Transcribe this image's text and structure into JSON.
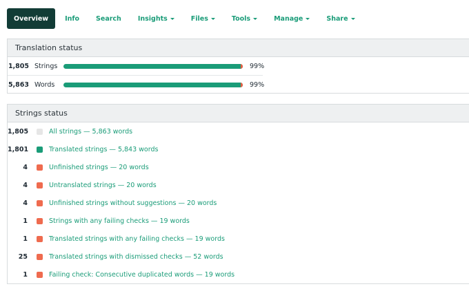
{
  "nav": {
    "tabs": [
      {
        "label": "Overview",
        "active": true,
        "dropdown": false
      },
      {
        "label": "Info",
        "active": false,
        "dropdown": false
      },
      {
        "label": "Search",
        "active": false,
        "dropdown": false
      },
      {
        "label": "Insights",
        "active": false,
        "dropdown": true
      },
      {
        "label": "Files",
        "active": false,
        "dropdown": true
      },
      {
        "label": "Tools",
        "active": false,
        "dropdown": true
      },
      {
        "label": "Manage",
        "active": false,
        "dropdown": true
      },
      {
        "label": "Share",
        "active": false,
        "dropdown": true
      }
    ]
  },
  "translation_status": {
    "title": "Translation status",
    "rows": [
      {
        "count": "1,805",
        "label": "Strings",
        "percent": "99%",
        "progress": 0.99
      },
      {
        "count": "5,863",
        "label": "Words",
        "percent": "99%",
        "progress": 0.99
      }
    ]
  },
  "strings_status": {
    "title": "Strings status",
    "items": [
      {
        "count": "1,805",
        "color": "#e6e6e6",
        "text": "All strings — 5,863 words"
      },
      {
        "count": "1,801",
        "color": "#1a9c78",
        "text": "Translated strings — 5,843 words"
      },
      {
        "count": "4",
        "color": "#ef6b4f",
        "text": "Unfinished strings — 20 words"
      },
      {
        "count": "4",
        "color": "#ef6b4f",
        "text": "Untranslated strings — 20 words"
      },
      {
        "count": "4",
        "color": "#ef6b4f",
        "text": "Unfinished strings without suggestions — 20 words"
      },
      {
        "count": "1",
        "color": "#ef6b4f",
        "text": "Strings with any failing checks — 19 words"
      },
      {
        "count": "1",
        "color": "#ef6b4f",
        "text": "Translated strings with any failing checks — 19 words"
      },
      {
        "count": "25",
        "color": "#ef6b4f",
        "text": "Translated strings with dismissed checks — 52 words"
      },
      {
        "count": "1",
        "color": "#ef6b4f",
        "text": "Failing check: Consecutive duplicated words — 19 words"
      }
    ]
  },
  "colors": {
    "accent": "#1a9c78",
    "nav_active_bg": "#123c36",
    "warning": "#ef6b4f"
  }
}
